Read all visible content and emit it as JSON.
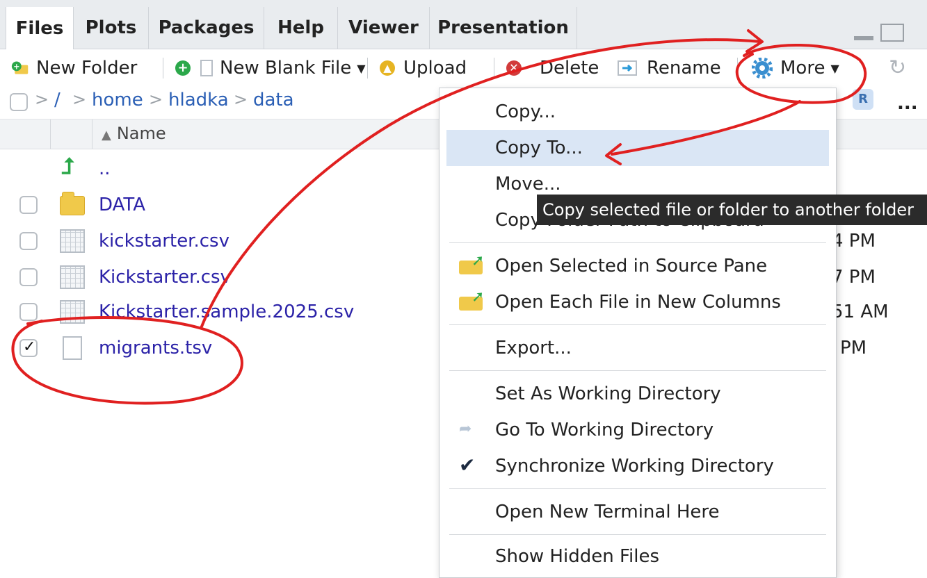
{
  "tabs": [
    {
      "label": "Files",
      "active": true
    },
    {
      "label": "Plots"
    },
    {
      "label": "Packages"
    },
    {
      "label": "Help"
    },
    {
      "label": "Viewer"
    },
    {
      "label": "Presentation"
    }
  ],
  "toolbar": {
    "new_folder": "New Folder",
    "new_blank_file": "New Blank File",
    "upload": "Upload",
    "delete": "Delete",
    "rename": "Rename",
    "more": "More"
  },
  "breadcrumb": {
    "root": "/",
    "items": [
      "home",
      "hladka",
      "data"
    ]
  },
  "columns": {
    "name": "Name"
  },
  "files": [
    {
      "name": "..",
      "type": "up"
    },
    {
      "name": "DATA",
      "type": "folder"
    },
    {
      "name": "kickstarter.csv",
      "type": "table"
    },
    {
      "name": "Kickstarter.csv",
      "type": "table"
    },
    {
      "name": "Kickstarter.sample.2025.csv",
      "type": "table"
    },
    {
      "name": "migrants.tsv",
      "type": "doc",
      "checked": true
    }
  ],
  "time_fragments": [
    "4 PM",
    "7 PM",
    "51 AM",
    "PM"
  ],
  "menu": {
    "items": [
      {
        "label": "Copy..."
      },
      {
        "label": "Copy To...",
        "highlighted": true
      },
      {
        "label": "Move..."
      },
      {
        "label": "Copy Folder Path to Clipboard"
      },
      {
        "label": "Open Selected in Source Pane",
        "icon": "open-folder-icon"
      },
      {
        "label": "Open Each File in New Columns",
        "icon": "open-folder-icon"
      },
      {
        "label": "Export..."
      },
      {
        "label": "Set As Working Directory"
      },
      {
        "label": "Go To Working Directory",
        "icon": "goto-arrow-icon"
      },
      {
        "label": "Synchronize Working Directory",
        "icon": "checkmark-icon"
      },
      {
        "label": "Open New Terminal Here"
      },
      {
        "label": "Show Hidden Files"
      }
    ]
  },
  "tooltip": "Copy selected file or folder to another folder",
  "colors": {
    "link": "#2b5fb5",
    "file_link": "#2b22a8",
    "highlight": "#dae6f5",
    "annotation": "#e02020"
  }
}
